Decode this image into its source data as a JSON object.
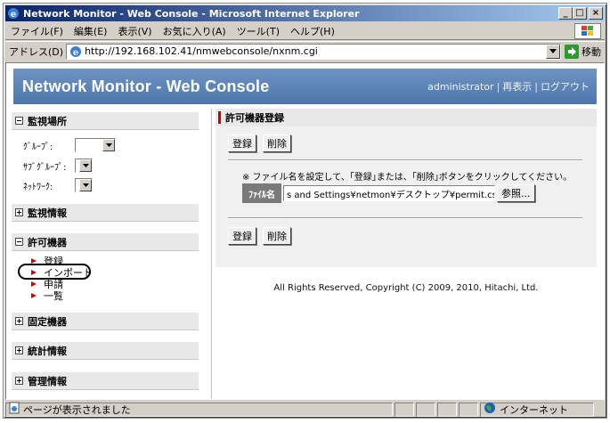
{
  "window": {
    "title": "Network Monitor - Web Console - Microsoft Internet Explorer",
    "minimize": "_",
    "maximize": "□",
    "close": "×"
  },
  "menu": [
    "ファイル(F)",
    "編集(E)",
    "表示(V)",
    "お気に入り(A)",
    "ツール(T)",
    "ヘルプ(H)"
  ],
  "address": {
    "label": "アドレス(D)",
    "url": "http://192.168.102.41/nmwebconsole/nxnm.cgi",
    "go_label": "移動"
  },
  "header": {
    "title": "Network Monitor - Web Console",
    "links": [
      "administrator",
      "再表示",
      "ログアウト"
    ]
  },
  "sidebar": {
    "monitor_location": {
      "title": "監視場所",
      "fields": [
        {
          "label": "ｸﾞﾙｰﾌﾟ:"
        },
        {
          "label": "ｻﾌﾞｸﾞﾙｰﾌﾟ:"
        },
        {
          "label": "ﾈｯﾄﾜｰｸ:"
        }
      ]
    },
    "monitor_info": {
      "title": "監視情報"
    },
    "permitted_devices": {
      "title": "許可機器",
      "items": [
        "登録",
        "インポート",
        "申請",
        "一覧"
      ]
    },
    "fixed_devices": {
      "title": "固定機器"
    },
    "statistics": {
      "title": "統計情報"
    },
    "management": {
      "title": "管理情報"
    }
  },
  "main": {
    "title": "許可機器登録",
    "register_label": "登録",
    "delete_label": "削除",
    "note": "※ ファイル名を設定して、｢登録｣または、｢削除｣ボタンをクリックしてください。",
    "file_label": "ﾌｧｲﾙ名",
    "file_value": "s and Settings¥netmon¥デスクトップ¥permit.csv",
    "browse_label": "参照..."
  },
  "footer": {
    "copyright": "All Rights Reserved, Copyright (C) 2009, 2010, Hitachi, Ltd."
  },
  "status": {
    "text": "ページが表示されました",
    "zone": "インターネット"
  }
}
